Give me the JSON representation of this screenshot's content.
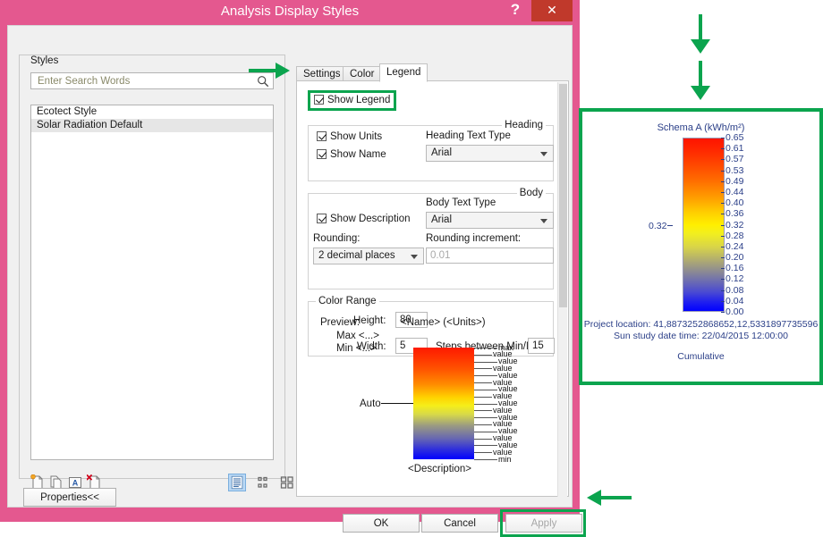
{
  "window": {
    "title": "Analysis Display Styles",
    "help_label": "?",
    "close_label": "✕",
    "help_icon": "question-mark-icon",
    "close_icon": "close-x-icon",
    "accent_pink": "#e4588f",
    "highlight_green": "#0ba44e"
  },
  "styles_panel": {
    "group_title": "Styles",
    "search": {
      "placeholder": "Enter Search Words",
      "value": "",
      "icon": "search-magnifier-icon"
    },
    "list": [
      {
        "label": "Ecotect Style",
        "selected": false
      },
      {
        "label": "Solar Radiation Default",
        "selected": true
      }
    ],
    "toolbar_icons": [
      {
        "name": "new-style-icon",
        "title": "New"
      },
      {
        "name": "duplicate-style-icon",
        "title": "Duplicate"
      },
      {
        "name": "rename-style-icon",
        "title": "Rename"
      },
      {
        "name": "delete-style-icon",
        "title": "Delete"
      }
    ],
    "view_icons": [
      {
        "name": "list-view-icon",
        "active": true
      },
      {
        "name": "small-icons-view-icon",
        "active": false
      },
      {
        "name": "large-icons-view-icon",
        "active": false
      }
    ],
    "properties_button": "Properties<<"
  },
  "tabs": [
    {
      "label": "Settings",
      "active": false
    },
    {
      "label": "Color",
      "active": false
    },
    {
      "label": "Legend",
      "active": true
    }
  ],
  "legend_tab": {
    "show_legend": {
      "label": "Show Legend",
      "checked": true,
      "highlighted": true
    },
    "heading_group": {
      "title": "Heading",
      "show_units": {
        "label": "Show Units",
        "checked": true
      },
      "show_name": {
        "label": "Show Name",
        "checked": true
      },
      "text_type_label": "Heading Text Type",
      "text_type_value": "Arial"
    },
    "body_group": {
      "title": "Body",
      "show_description": {
        "label": "Show Description",
        "checked": true
      },
      "text_type_label": "Body Text Type",
      "text_type_value": "Arial",
      "rounding_label": "Rounding:",
      "rounding_value": "2 decimal places",
      "rounding_increment_label": "Rounding increment:",
      "rounding_increment_value": "0.01"
    },
    "color_range": {
      "title": "Color Range",
      "height_label": "Height:",
      "height_value": "80",
      "width_label": "Width:",
      "width_value": "5",
      "steps_label": "Steps between Min/Max:",
      "steps_value": "15"
    },
    "preview": {
      "label": "Preview:",
      "max_label": "Max <...>",
      "min_label": "Min <...>",
      "heading_sample": "<Name> (<Units>)",
      "auto_label": "Auto",
      "description_sample": "<Description>",
      "tick_labels": [
        "max",
        "value",
        "value",
        "value",
        "value",
        "value",
        "value",
        "value",
        "value",
        "value",
        "value",
        "value",
        "value",
        "value",
        "value",
        "value",
        "min"
      ]
    }
  },
  "dialog_buttons": {
    "ok": "OK",
    "cancel": "Cancel",
    "apply": "Apply",
    "apply_disabled": true,
    "apply_highlighted": true
  },
  "chart_data": {
    "type": "heatmap",
    "title": "Schema A (kWh/m²)",
    "legend_kind": "continuous-color-scale",
    "units": "kWh/m²",
    "series_name": "Schema A",
    "ylim": [
      0.0,
      0.65
    ],
    "tick_values": [
      0.65,
      0.61,
      0.57,
      0.53,
      0.49,
      0.44,
      0.4,
      0.36,
      0.32,
      0.28,
      0.24,
      0.2,
      0.16,
      0.12,
      0.08,
      0.04,
      0.0
    ],
    "tick_labels": [
      "0.65",
      "0.61",
      "0.57",
      "0.53",
      "0.49",
      "0.44",
      "0.40",
      "0.36",
      "0.32",
      "0.28",
      "0.24",
      "0.20",
      "0.16",
      "0.12",
      "0.08",
      "0.04",
      "0.00"
    ],
    "left_marker_label": "0.32",
    "left_marker_value": 0.32,
    "steps_between_min_max": 15,
    "colormap": [
      "#0000ff",
      "#ffef00",
      "#fe1400"
    ],
    "colormap_name": "blue-yellow-red",
    "grid": false,
    "legend_position": "right",
    "annotations": [
      "Project location: 41,8873252868652,12,5331897735596",
      "Sun study date time: 22/04/2015 12:00:00",
      "Cumulative"
    ],
    "footer": {
      "project_location": "Project location: 41,8873252868652,12,5331897735596",
      "sun_study": "Sun study date time: 22/04/2015 12:00:00",
      "mode": "Cumulative"
    }
  },
  "annotations": {
    "arrow_to_show_legend": "green-right-arrow",
    "arrow_to_legend_panel_1": "green-down-arrow",
    "arrow_to_legend_panel_2": "green-down-arrow",
    "arrow_to_apply": "green-left-arrow"
  }
}
